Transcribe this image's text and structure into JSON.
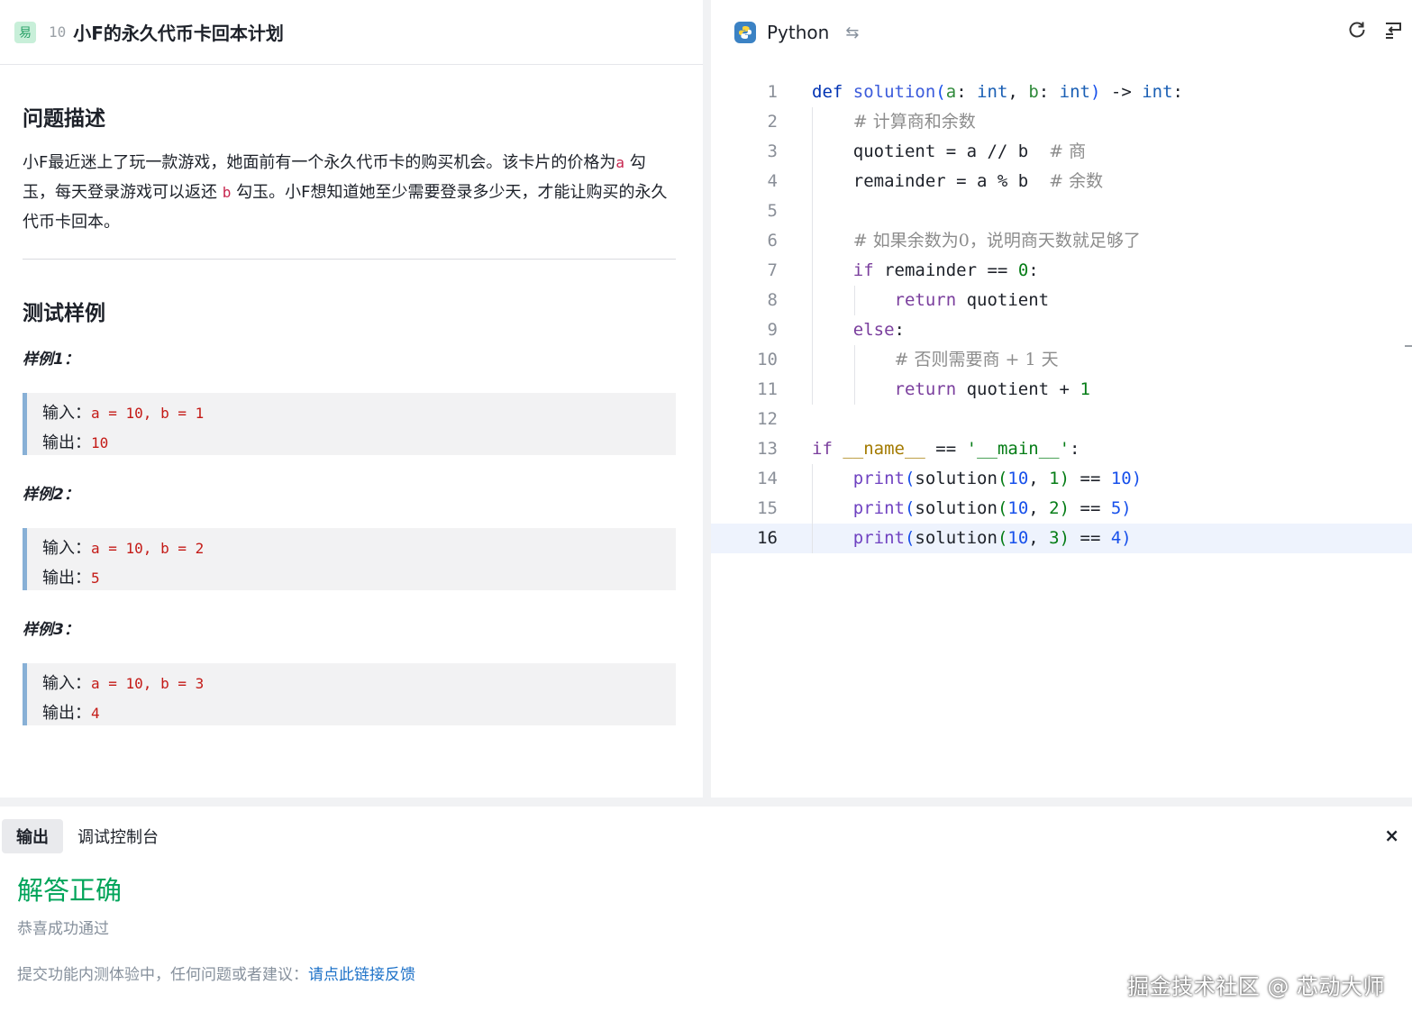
{
  "problem": {
    "difficulty": "易",
    "number": "10",
    "title": "小F的永久代币卡回本计划",
    "section_desc": "问题描述",
    "desc_1": "小F最近迷上了玩一款游戏，她面前有一个永久代币卡的购买机会。该卡片的价格为",
    "var_a": "a",
    "desc_2": " 勾玉，每天登录游戏可以返还 ",
    "var_b": "b",
    "desc_3": " 勾玉。小F想知道她至少需要登录多少天，才能让购买的永久代币卡回本。",
    "section_tests": "测试样例",
    "input_label": "输入：",
    "output_label": "输出：",
    "examples": [
      {
        "label": "样例1：",
        "input": "a = 10, b = 1",
        "output": "10"
      },
      {
        "label": "样例2：",
        "input": "a = 10, b = 2",
        "output": "5"
      },
      {
        "label": "样例3：",
        "input": "a = 10, b = 3",
        "output": "4"
      }
    ]
  },
  "editor": {
    "language": "Python",
    "active_line": "16",
    "line_numbers": [
      "1",
      "2",
      "3",
      "4",
      "5",
      "6",
      "7",
      "8",
      "9",
      "10",
      "11",
      "12",
      "13",
      "14",
      "15",
      "16"
    ],
    "icons": [
      "python-icon",
      "swap-icon",
      "refresh-icon",
      "format-icon"
    ]
  },
  "bottom": {
    "tab_output": "输出",
    "tab_console": "调试控制台",
    "close": "×",
    "result": "解答正确",
    "result_color": "#00a45a",
    "sub": "恭喜成功通过",
    "feedback_text": "提交功能内测体验中，任何问题或者建议：",
    "feedback_link": "请点此链接反馈",
    "watermark": "掘金技术社区 @ 芯动大师"
  }
}
